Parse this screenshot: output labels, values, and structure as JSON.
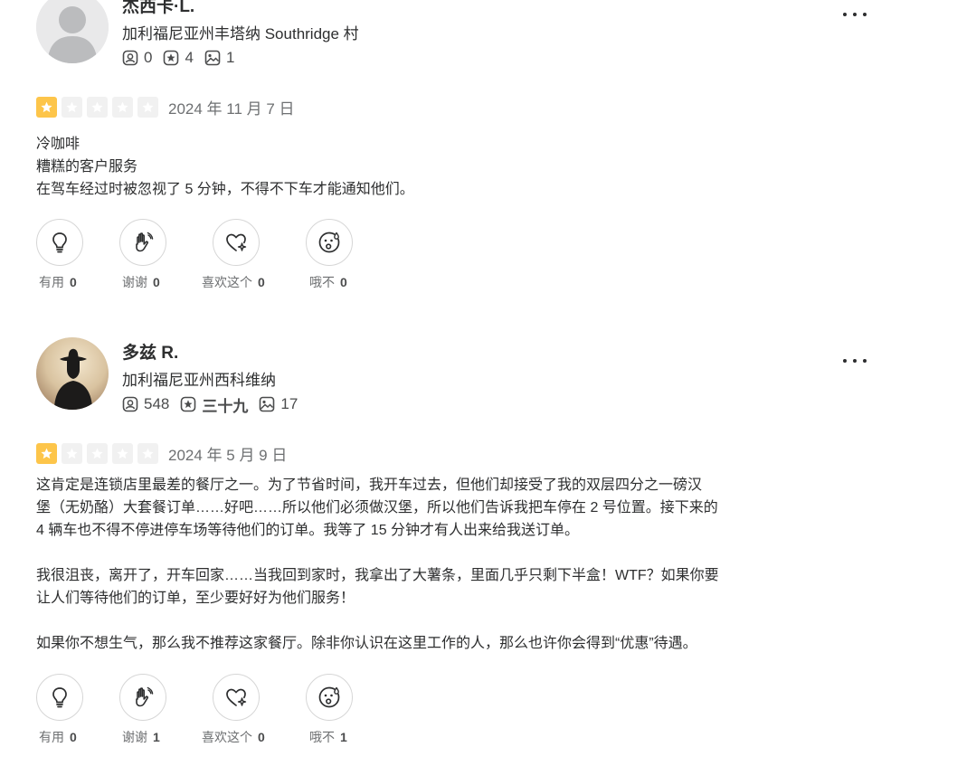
{
  "colors": {
    "star_on": "#fdc54a",
    "star_off": "#f1f1f1",
    "text": "#2d2e2f",
    "muted": "#6e7072"
  },
  "reviews": [
    {
      "name": "杰西卡·L.",
      "location": "加利福尼亚州丰塔纳 Southridge 村",
      "stats": {
        "reviews": "0",
        "friends": "4",
        "photos": "1"
      },
      "rating": 1,
      "date": "2024 年 11 月 7 日",
      "body": [
        "冷咖啡",
        "糟糕的客户服务",
        "在驾车经过时被忽视了 5 分钟，不得不下车才能通知他们。"
      ],
      "reactions": [
        {
          "icon": "lightbulb-icon",
          "label": "有用",
          "count": "0"
        },
        {
          "icon": "wave-hand-icon",
          "label": "谢谢",
          "count": "0"
        },
        {
          "icon": "heart-sparkle-icon",
          "label": "喜欢这个",
          "count": "0"
        },
        {
          "icon": "oh-no-face-icon",
          "label": "哦不",
          "count": "0"
        }
      ]
    },
    {
      "name": "多兹 R.",
      "location": "加利福尼亚州西科维纳",
      "stats": {
        "reviews": "548",
        "friends": "三十九",
        "photos": "17"
      },
      "rating": 1,
      "date": "2024 年 5 月 9 日",
      "body": [
        "这肯定是连锁店里最差的餐厅之一。为了节省时间，我开车过去，但他们却接受了我的双层四分之一磅汉",
        "堡（无奶酪）大套餐订单……好吧……所以他们必须做汉堡，所以他们告诉我把车停在 2 号位置。接下来的",
        "4 辆车也不得不停进停车场等待他们的订单。我等了 15 分钟才有人出来给我送订单。",
        "",
        "我很沮丧，离开了，开车回家……当我回到家时，我拿出了大薯条，里面几乎只剩下半盒！WTF？如果你要",
        "让人们等待他们的订单，至少要好好为他们服务！",
        "",
        "如果你不想生气，那么我不推荐这家餐厅。除非你认识在这里工作的人，那么也许你会得到“优惠”待遇。"
      ],
      "reactions": [
        {
          "icon": "lightbulb-icon",
          "label": "有用",
          "count": "0"
        },
        {
          "icon": "wave-hand-icon",
          "label": "谢谢",
          "count": "1"
        },
        {
          "icon": "heart-sparkle-icon",
          "label": "喜欢这个",
          "count": "0"
        },
        {
          "icon": "oh-no-face-icon",
          "label": "哦不",
          "count": "1"
        }
      ]
    }
  ]
}
